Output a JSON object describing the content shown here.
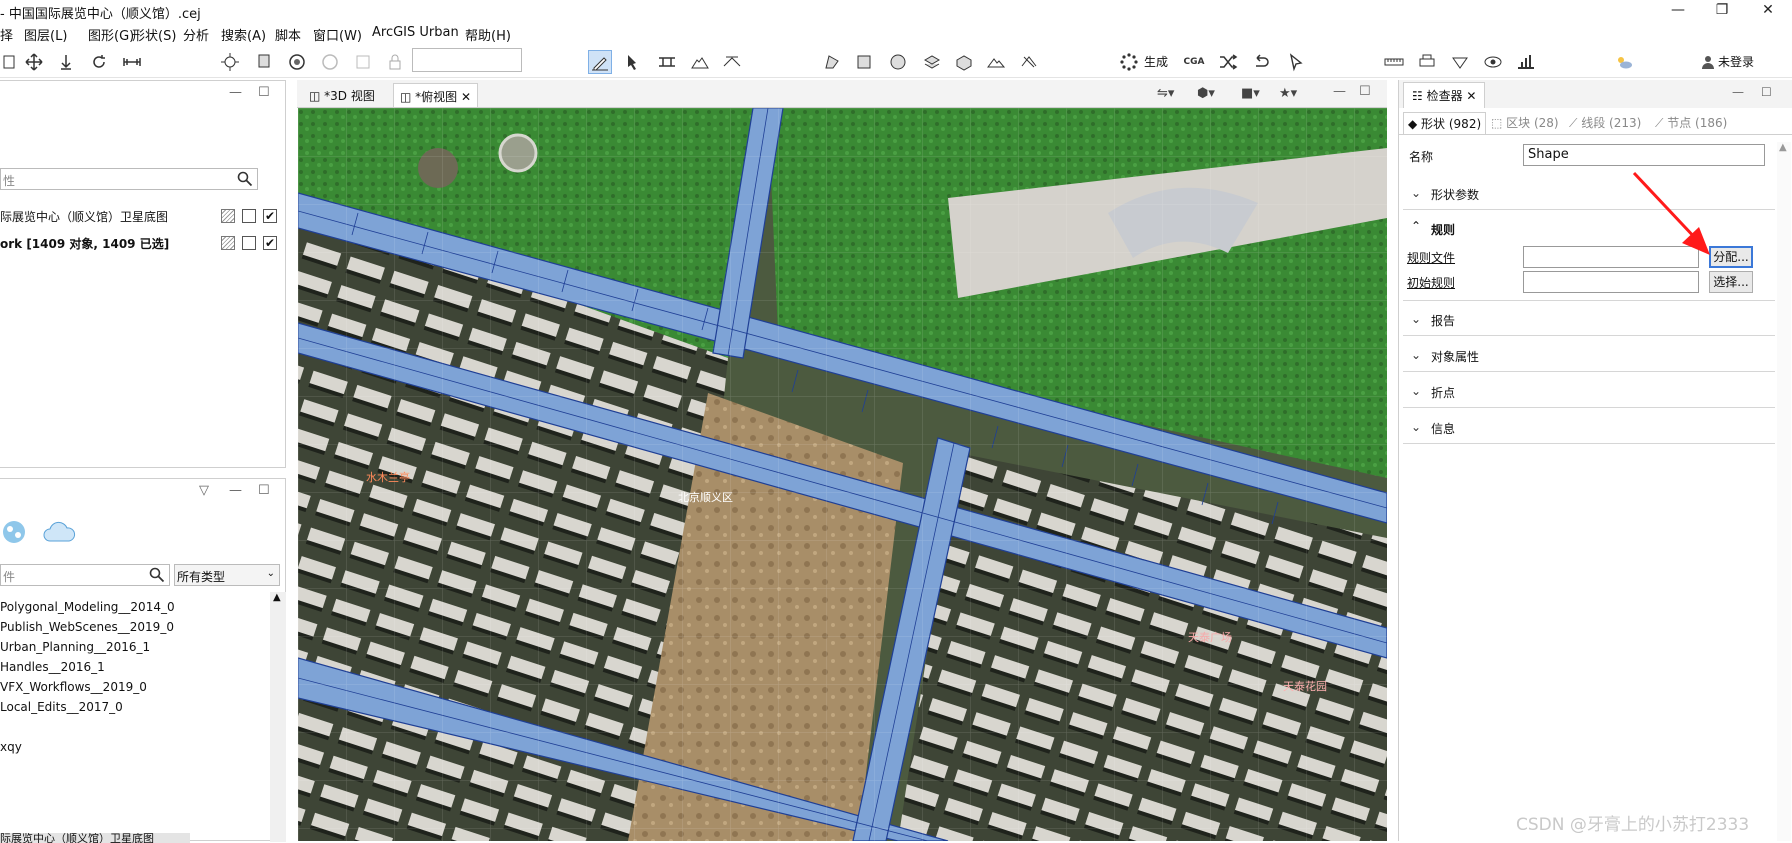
{
  "window": {
    "title": "- 中国国际展览中心（顺义馆）.cej",
    "controls": {
      "minimize": "—",
      "maximize": "❐",
      "close": "✕"
    }
  },
  "menu": [
    "择",
    "图层(L)",
    "图形(G)",
    "形状(S)",
    "分析",
    "搜索(A)",
    "脚本",
    "窗口(W)",
    "ArcGIS Urban",
    "帮助(H)"
  ],
  "toolbar": {
    "generate_label": "生成",
    "cga_label": "CGA",
    "login_label": "未登录",
    "search_value": ""
  },
  "scene_panel": {
    "search_placeholder": "性",
    "layers": [
      {
        "name": "际展览中心（顺义馆）卫星底图",
        "visible": true
      },
      {
        "name": "ork [1409 对象, 1409 已选]",
        "visible": true
      }
    ]
  },
  "navigator_panel": {
    "search_placeholder": "件",
    "type_filter": "所有类型",
    "files": [
      "Polygonal_Modeling__2014_0",
      "Publish_WebScenes__2019_0",
      "Urban_Planning__2016_1",
      "Handles__2016_1",
      "VFX_Workflows__2019_0",
      "Local_Edits__2017_0",
      "",
      "xqy"
    ],
    "status_item": "际展览中心（顺义馆）卫星底图"
  },
  "viewport": {
    "tabs": [
      {
        "label": "*3D 视图",
        "active": false
      },
      {
        "label": "*俯视图",
        "active": true
      }
    ],
    "map_labels": [
      "天泰广场",
      "水木兰亭",
      "北京顺义区",
      "天泰花园"
    ]
  },
  "inspector": {
    "title": "检查器",
    "tabs": [
      {
        "label": "形状 (982)",
        "active": true
      },
      {
        "label": "区块 (28)",
        "active": false
      },
      {
        "label": "线段 (213)",
        "active": false
      },
      {
        "label": "节点 (186)",
        "active": false
      }
    ],
    "name_label": "名称",
    "name_value": "Shape",
    "sections": {
      "shape_params": "形状参数",
      "rules": "规则",
      "report": "报告",
      "object_attrs": "对象属性",
      "vertices": "折点",
      "info": "信息"
    },
    "rule_file_label": "规则文件",
    "rule_file_value": "",
    "start_rule_label": "初始规则",
    "start_rule_value": "",
    "assign_button": "分配...",
    "select_button": "选择..."
  },
  "watermark": "CSDN @牙膏上的小苏打2333",
  "colors": {
    "road_fill": "#7ea3d6",
    "road_line": "#1f3f95",
    "annotation_arrow": "#ff1a1a"
  }
}
